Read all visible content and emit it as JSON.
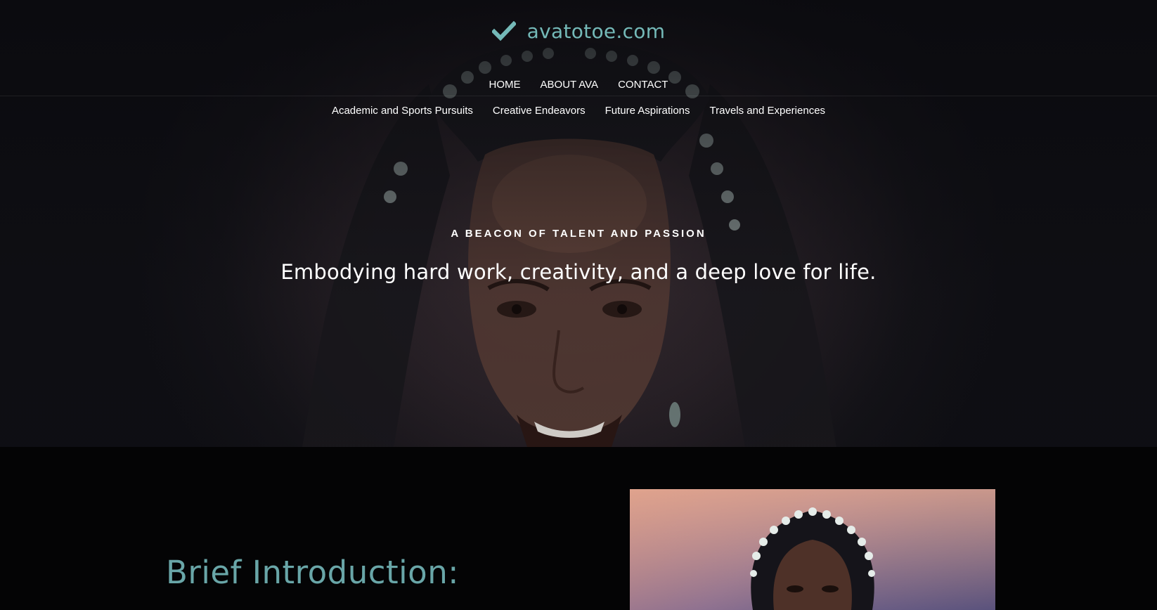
{
  "site": {
    "logo_text": "avatotoe.com",
    "accent_color": "#74b9b8"
  },
  "nav": {
    "primary": [
      {
        "label": "HOME"
      },
      {
        "label": "ABOUT AVA"
      },
      {
        "label": "CONTACT"
      }
    ],
    "secondary": [
      {
        "label": "Academic and Sports Pursuits"
      },
      {
        "label": "Creative Endeavors"
      },
      {
        "label": "Future Aspirations"
      },
      {
        "label": "Travels and Experiences"
      }
    ]
  },
  "hero": {
    "kicker": "A BEACON OF TALENT AND PASSION",
    "headline": "Embodying hard work, creativity, and a deep love for life."
  },
  "intro": {
    "title": "Brief Introduction:"
  },
  "icons": {
    "logo": "checkmark-icon"
  }
}
